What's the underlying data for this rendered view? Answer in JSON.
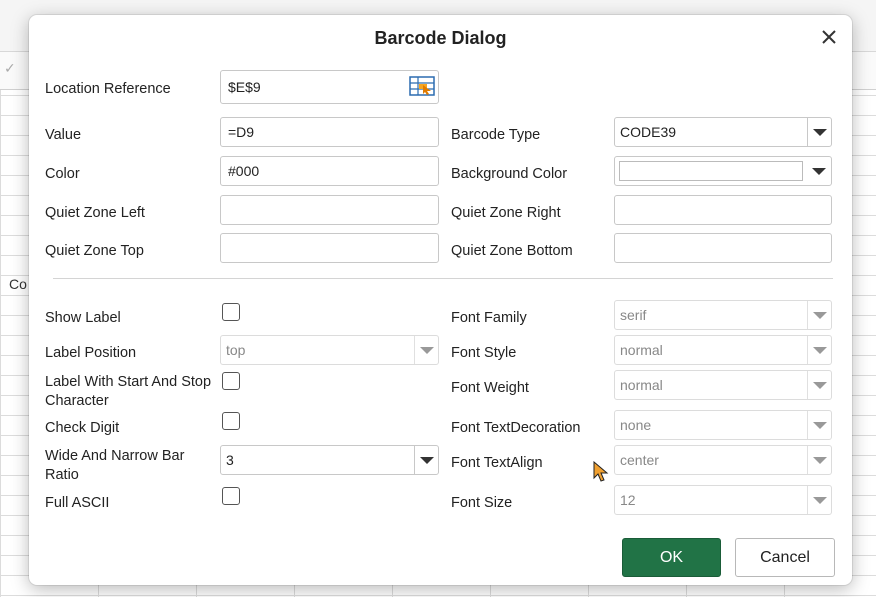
{
  "background": {
    "cell_text": "Co"
  },
  "dialog": {
    "title": "Barcode Dialog",
    "close_icon": "close-icon",
    "location_reference": {
      "label": "Location Reference",
      "value": "$E$9",
      "icon": "range-select-icon"
    },
    "value": {
      "label": "Value",
      "value": "=D9"
    },
    "barcode_type": {
      "label": "Barcode Type",
      "value": "CODE39"
    },
    "color": {
      "label": "Color",
      "value": "#000"
    },
    "background_color": {
      "label": "Background Color",
      "value": ""
    },
    "quiet_zone_left": {
      "label": "Quiet Zone Left",
      "value": ""
    },
    "quiet_zone_right": {
      "label": "Quiet Zone Right",
      "value": ""
    },
    "quiet_zone_top": {
      "label": "Quiet Zone Top",
      "value": ""
    },
    "quiet_zone_bottom": {
      "label": "Quiet Zone Bottom",
      "value": ""
    },
    "show_label": {
      "label": "Show Label",
      "checked": false
    },
    "label_position": {
      "label": "Label Position",
      "value": "top"
    },
    "label_start_stop": {
      "label_line1": "Label With Start And Stop",
      "label_line2": "Character",
      "checked": false
    },
    "check_digit": {
      "label": "Check Digit",
      "checked": false
    },
    "wide_narrow_ratio": {
      "label_line1": "Wide And Narrow Bar",
      "label_line2": "Ratio",
      "value": "3"
    },
    "full_ascii": {
      "label": "Full ASCII",
      "checked": false
    },
    "font_family": {
      "label": "Font Family",
      "value": "serif"
    },
    "font_style": {
      "label": "Font Style",
      "value": "normal"
    },
    "font_weight": {
      "label": "Font Weight",
      "value": "normal"
    },
    "font_text_decoration": {
      "label": "Font TextDecoration",
      "value": "none"
    },
    "font_text_align": {
      "label": "Font TextAlign",
      "value": "center"
    },
    "font_size": {
      "label": "Font Size",
      "value": "12"
    },
    "ok_label": "OK",
    "cancel_label": "Cancel",
    "accent_color": "#217346"
  }
}
